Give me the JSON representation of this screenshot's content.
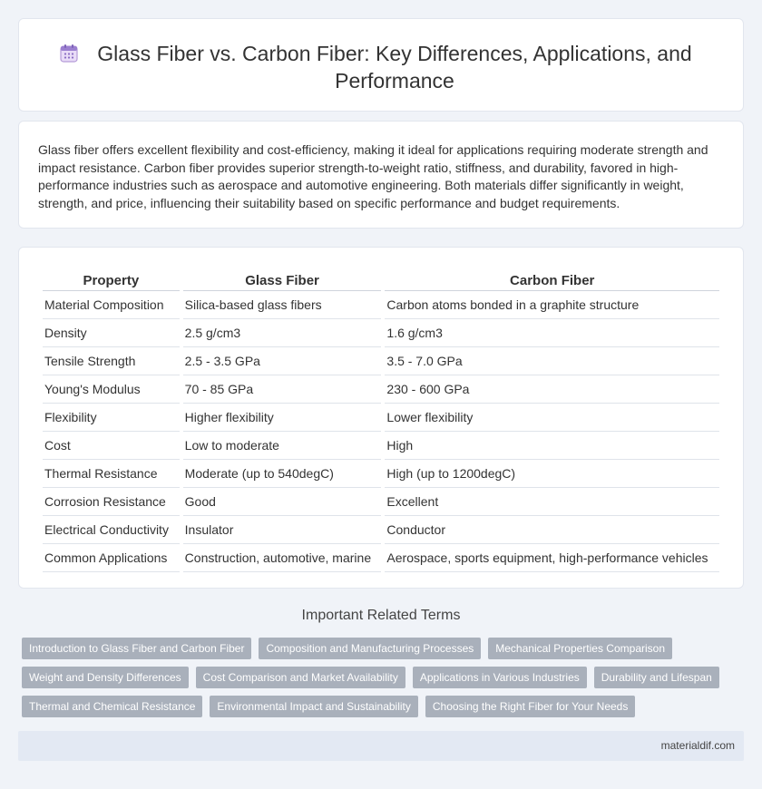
{
  "header": {
    "title": "Glass Fiber vs. Carbon Fiber: Key Differences, Applications, and Performance",
    "icon": "calendar-icon"
  },
  "intro": {
    "text": "Glass fiber offers excellent flexibility and cost-efficiency, making it ideal for applications requiring moderate strength and impact resistance. Carbon fiber provides superior strength-to-weight ratio, stiffness, and durability, favored in high-performance industries such as aerospace and automotive engineering. Both materials differ significantly in weight, strength, and price, influencing their suitability based on specific performance and budget requirements."
  },
  "table": {
    "headers": [
      "Property",
      "Glass Fiber",
      "Carbon Fiber"
    ],
    "rows": [
      [
        "Material Composition",
        "Silica-based glass fibers",
        "Carbon atoms bonded in a graphite structure"
      ],
      [
        "Density",
        "2.5 g/cm3",
        "1.6 g/cm3"
      ],
      [
        "Tensile Strength",
        "2.5 - 3.5 GPa",
        "3.5 - 7.0 GPa"
      ],
      [
        "Young's Modulus",
        "70 - 85 GPa",
        "230 - 600 GPa"
      ],
      [
        "Flexibility",
        "Higher flexibility",
        "Lower flexibility"
      ],
      [
        "Cost",
        "Low to moderate",
        "High"
      ],
      [
        "Thermal Resistance",
        "Moderate (up to 540degC)",
        "High (up to 1200degC)"
      ],
      [
        "Corrosion Resistance",
        "Good",
        "Excellent"
      ],
      [
        "Electrical Conductivity",
        "Insulator",
        "Conductor"
      ],
      [
        "Common Applications",
        "Construction, automotive, marine",
        "Aerospace, sports equipment, high-performance vehicles"
      ]
    ]
  },
  "related": {
    "title": "Important Related Terms",
    "rows": [
      [
        "Introduction to Glass Fiber and Carbon Fiber",
        "Composition and Manufacturing Processes",
        "Mechanical Properties Comparison"
      ],
      [
        "Weight and Density Differences",
        "Cost Comparison and Market Availability",
        "Applications in Various Industries",
        "Durability and Lifespan"
      ],
      [
        "Thermal and Chemical Resistance",
        "Environmental Impact and Sustainability",
        "Choosing the Right Fiber for Your Needs"
      ]
    ]
  },
  "footer": {
    "site": "materialdif.com"
  },
  "colors": {
    "background": "#f0f3f8",
    "tag": "#a9b0bb",
    "footer": "#e3e9f3"
  }
}
